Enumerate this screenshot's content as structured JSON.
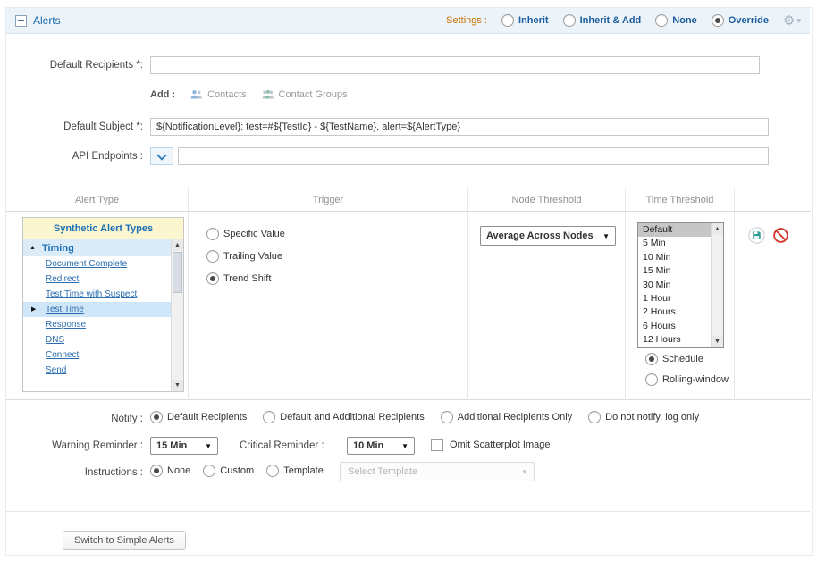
{
  "header": {
    "title": "Alerts",
    "settings_label": "Settings :",
    "options": [
      {
        "label": "Inherit",
        "selected": false
      },
      {
        "label": "Inherit & Add",
        "selected": false
      },
      {
        "label": "None",
        "selected": false
      },
      {
        "label": "Override",
        "selected": true
      }
    ]
  },
  "form": {
    "default_recipients_label": "Default Recipients *:",
    "default_recipients_value": "",
    "add_label": "Add :",
    "contacts_label": "Contacts",
    "contact_groups_label": "Contact Groups",
    "default_subject_label": "Default Subject *:",
    "default_subject_value": "${NotificationLevel}: test=#${TestId} - ${TestName}, alert=${AlertType}",
    "api_endpoints_label": "API Endpoints :",
    "api_endpoints_value": ""
  },
  "table": {
    "headers": {
      "alert_type": "Alert Type",
      "trigger": "Trigger",
      "node_threshold": "Node Threshold",
      "time_threshold": "Time Threshold"
    },
    "alert_types": {
      "title": "Synthetic Alert Types",
      "group_label": "Timing",
      "items": [
        {
          "label": "Document Complete",
          "selected": false
        },
        {
          "label": "Redirect",
          "selected": false
        },
        {
          "label": "Test Time with Suspect",
          "selected": false
        },
        {
          "label": "Test Time",
          "selected": true
        },
        {
          "label": "Response",
          "selected": false
        },
        {
          "label": "DNS",
          "selected": false
        },
        {
          "label": "Connect",
          "selected": false
        },
        {
          "label": "Send",
          "selected": false
        }
      ]
    },
    "trigger_options": [
      {
        "label": "Specific Value",
        "selected": false
      },
      {
        "label": "Trailing Value",
        "selected": false
      },
      {
        "label": "Trend Shift",
        "selected": true
      }
    ],
    "node_threshold_value": "Average Across Nodes",
    "time_threshold": {
      "options": [
        {
          "label": "Default",
          "selected": true
        },
        {
          "label": "5 Min",
          "selected": false
        },
        {
          "label": "10 Min",
          "selected": false
        },
        {
          "label": "15 Min",
          "selected": false
        },
        {
          "label": "30 Min",
          "selected": false
        },
        {
          "label": "1 Hour",
          "selected": false
        },
        {
          "label": "2 Hours",
          "selected": false
        },
        {
          "label": "6 Hours",
          "selected": false
        },
        {
          "label": "12 Hours",
          "selected": false
        }
      ],
      "modes": [
        {
          "label": "Schedule",
          "selected": true
        },
        {
          "label": "Rolling-window",
          "selected": false
        }
      ]
    }
  },
  "notify": {
    "label": "Notify :",
    "options": [
      {
        "label": "Default Recipients",
        "selected": true
      },
      {
        "label": "Default and Additional Recipients",
        "selected": false
      },
      {
        "label": "Additional Recipients Only",
        "selected": false
      },
      {
        "label": "Do not notify, log only",
        "selected": false
      }
    ]
  },
  "reminders": {
    "warning_label": "Warning Reminder :",
    "warning_value": "15 Min",
    "critical_label": "Critical Reminder :",
    "critical_value": "10 Min",
    "omit_scatterplot_label": "Omit Scatterplot Image",
    "omit_scatterplot_checked": false
  },
  "instructions": {
    "label": "Instructions :",
    "options": [
      {
        "label": "None",
        "selected": true
      },
      {
        "label": "Custom",
        "selected": false
      },
      {
        "label": "Template",
        "selected": false
      }
    ],
    "template_placeholder": "Select Template"
  },
  "footer": {
    "switch_button_label": "Switch to Simple Alerts"
  },
  "icons": {
    "gear": "⚙",
    "menu_caret": "▾",
    "select_caret": "▼",
    "scroll_up": "▲",
    "scroll_down": "▼",
    "group_collapse": "▲"
  }
}
